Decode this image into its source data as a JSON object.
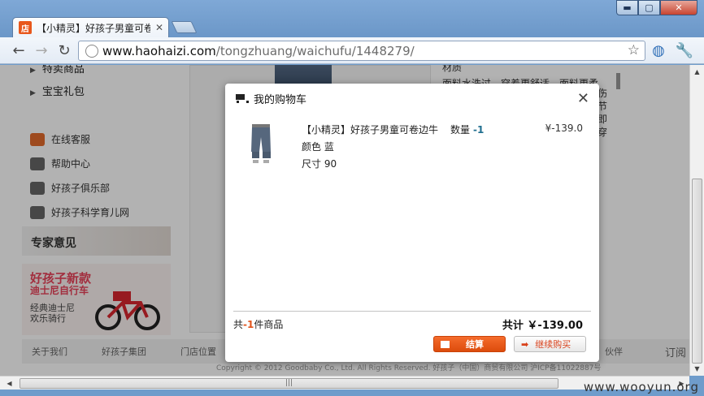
{
  "browser": {
    "tab_title": "【小精灵】好孩子男童可卷",
    "tab_favicon": "店",
    "url_host": "www.haohaizi.com",
    "url_path": "/tongzhuang/waichufu/1448279/",
    "icons": [
      "back-icon",
      "forward-icon",
      "reload-icon",
      "star-icon",
      "globe-icon",
      "wrench-icon"
    ]
  },
  "sidebar": {
    "partial_link": "特卖商品",
    "gift_link": "宝宝礼包",
    "services": [
      {
        "label": "在线客服"
      },
      {
        "label": "帮助中心"
      },
      {
        "label": "好孩子俱乐部"
      },
      {
        "label": "好孩子科学育儿网"
      }
    ],
    "expert": "专家意见",
    "promo": {
      "title1": "好孩子新款",
      "title2": "迪士尼自行车",
      "sub1": "经典迪士尼",
      "sub2": "欢乐骑行"
    }
  },
  "background_page": {
    "right_lines": [
      "材质",
      "面料水洗过，穿着更舒适，面料更柔",
      "伤",
      "节",
      "即",
      "穿"
    ],
    "footer_links": [
      "关于我们",
      "好孩子集团",
      "门店位置"
    ],
    "footer_right": "伙伴",
    "footer_far_right": "订阅",
    "copyright": "Copyright © 2012 Goodbaby Co., Ltd. All Rights Reserved.   好孩子（中国）商贸有限公司  沪ICP备11022887号"
  },
  "modal": {
    "title": "我的购物车",
    "item": {
      "name": "【小精灵】好孩子男童可卷边牛",
      "qty_label": "数量",
      "qty_value": "-1",
      "price": "¥-139.0",
      "color": "颜色 蓝",
      "size": "尺寸 90"
    },
    "count_prefix": "共",
    "count_value": "-1",
    "count_suffix": "件商品",
    "total": "共计 ￥-139.00",
    "checkout_label": "结算",
    "continue_label": "继续购买"
  },
  "watermark": "www.wooyun.org",
  "colors": {
    "accent_orange": "#dc4b0c",
    "window_blue": "#6f9ccb",
    "qty_blue": "#1f6e8f"
  }
}
